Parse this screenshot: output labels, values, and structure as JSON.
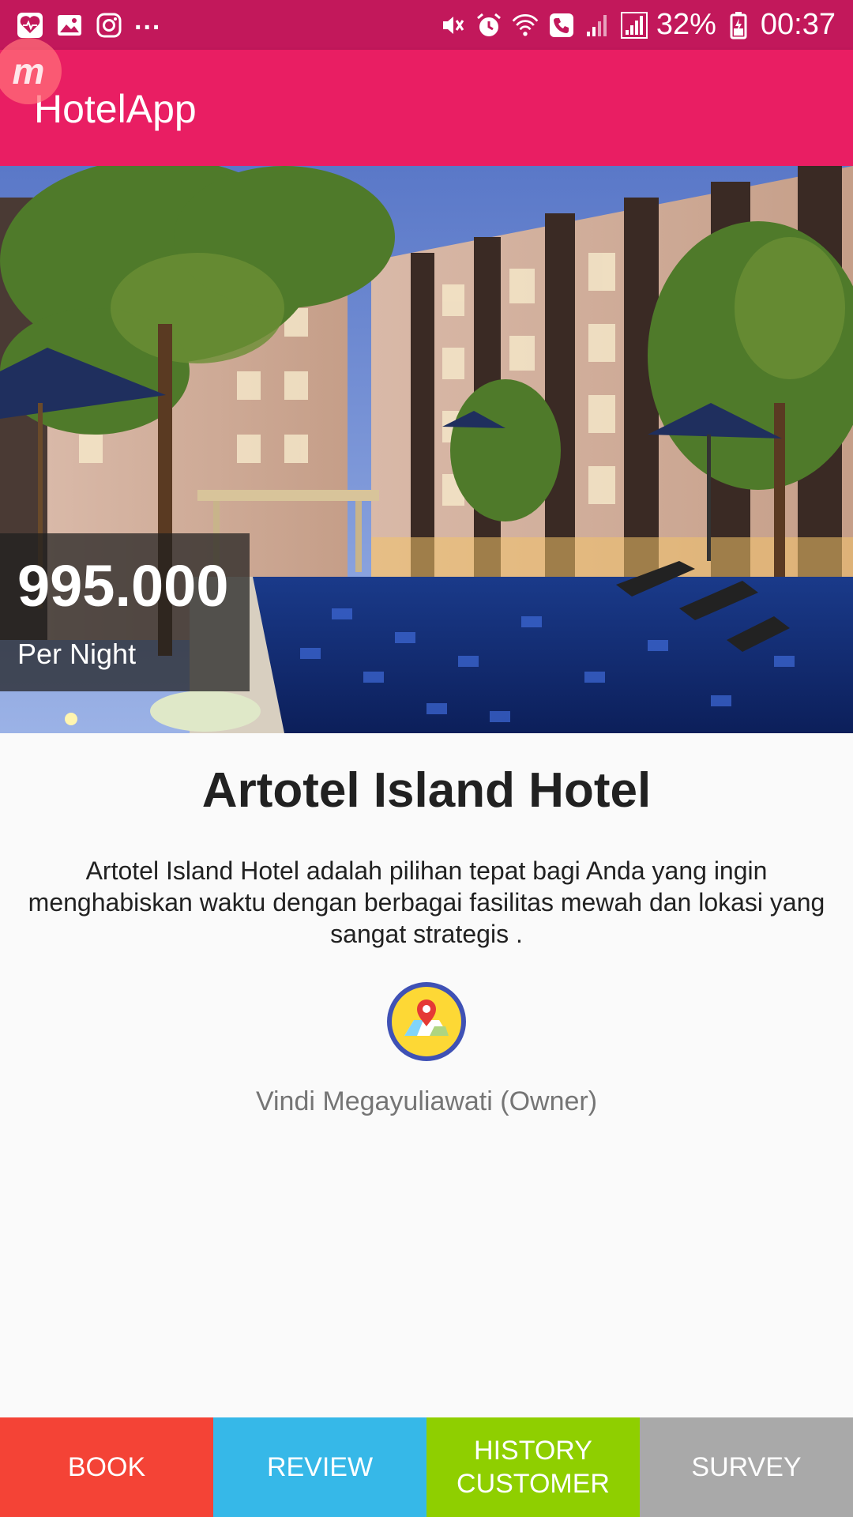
{
  "status_bar": {
    "more": "...",
    "battery": "32%",
    "time": "00:37",
    "icons": [
      "health-icon",
      "gallery-icon",
      "instagram-icon",
      "mute-icon",
      "alarm-icon",
      "wifi-call-icon",
      "signal-icon",
      "battery-icon"
    ]
  },
  "app_bar": {
    "title": "HotelApp",
    "badge": "m"
  },
  "hero": {
    "price": "995.000",
    "price_unit": "Per Night"
  },
  "hotel": {
    "name": "Artotel Island Hotel",
    "description": "Artotel Island Hotel adalah pilihan tepat bagi Anda yang ingin menghabiskan waktu dengan berbagai fasilitas mewah dan lokasi yang sangat strategis .",
    "owner": "Vindi Megayuliawati (Owner)"
  },
  "bottom_nav": {
    "book": "BOOK",
    "review": "REVIEW",
    "history_line1": "HISTORY",
    "history_line2": "CUSTOMER",
    "survey": "SURVEY"
  },
  "colors": {
    "status_bar": "#c2185b",
    "app_bar": "#e91e63",
    "book": "#f44336",
    "review": "#36b8e8",
    "history": "#8fcf00",
    "survey": "#a9a9a9"
  }
}
